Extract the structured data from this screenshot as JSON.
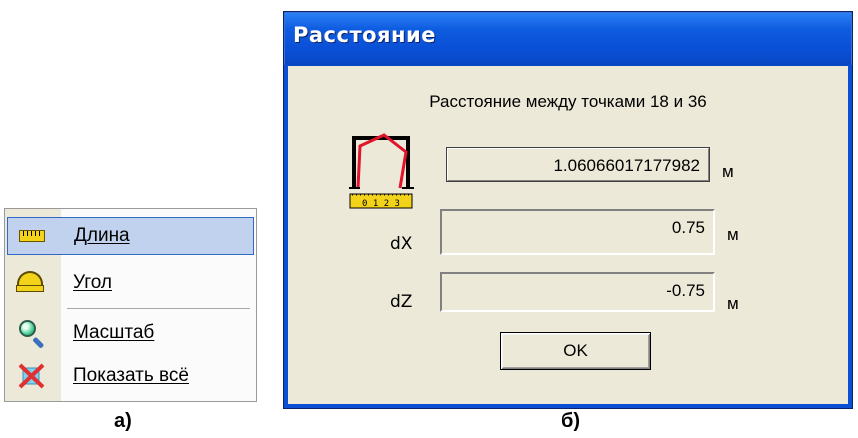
{
  "menu": {
    "items": [
      {
        "label": "Длина",
        "icon": "ruler-icon",
        "selected": true
      },
      {
        "label": "Угол",
        "icon": "protractor-icon",
        "selected": false
      },
      {
        "label": "Масштаб",
        "icon": "magnifier-icon",
        "selected": false
      },
      {
        "label": "Показать всё",
        "icon": "show-all-icon",
        "selected": false
      }
    ],
    "caption": "а)"
  },
  "dialog": {
    "title": "Расстояние",
    "heading": "Расстояние между точками 18 и 36",
    "distance": {
      "value": "1.06066017177982",
      "unit": "м"
    },
    "dx": {
      "label": "dX",
      "value": "0.75",
      "unit": "м"
    },
    "dz": {
      "label": "dZ",
      "value": "-0.75",
      "unit": "м"
    },
    "ok_label": "OK",
    "ruler_digits": "0 1 2 3",
    "caption": "б)"
  },
  "colors": {
    "titlebar": "#0a4fd6",
    "dialog_bg": "#ece9d8",
    "menu_highlight": "#c1d2ee",
    "icon_yellow": "#f2d31a",
    "frame_red": "#e0142a"
  }
}
